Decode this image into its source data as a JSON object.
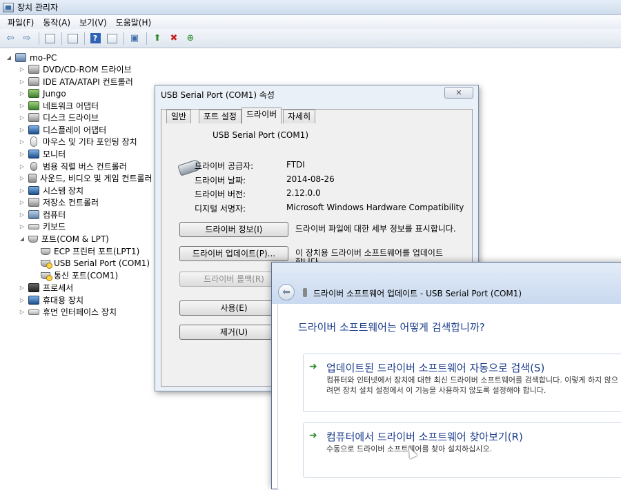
{
  "main_window": {
    "title": "장치 관리자",
    "menu": [
      "파일(F)",
      "동작(A)",
      "보기(V)",
      "도움말(H)"
    ]
  },
  "toolbar": {
    "icons": [
      "back-arrow-icon",
      "forward-arrow-icon",
      "console-tree-icon",
      "properties-icon",
      "help-icon",
      "action-pane-icon",
      "scan-hardware-icon",
      "update-driver-icon",
      "uninstall-icon",
      "enable-device-icon"
    ]
  },
  "tree": {
    "root": "mo-PC",
    "items": [
      {
        "label": "DVD/CD-ROM 드라이브",
        "icon": "disk-icon"
      },
      {
        "label": "IDE ATA/ATAPI 컨트롤러",
        "icon": "controller-icon"
      },
      {
        "label": "Jungo",
        "icon": "network-icon"
      },
      {
        "label": "네트워크 어댑터",
        "icon": "network-adapter-icon"
      },
      {
        "label": "디스크 드라이브",
        "icon": "disk-drive-icon"
      },
      {
        "label": "디스플레이 어댑터",
        "icon": "display-adapter-icon"
      },
      {
        "label": "마우스 및 기타 포인팅 장치",
        "icon": "mouse-icon"
      },
      {
        "label": "모니터",
        "icon": "monitor-icon"
      },
      {
        "label": "범용 직렬 버스 컨트롤러",
        "icon": "usb-icon"
      },
      {
        "label": "사운드, 비디오 및 게임 컨트롤러",
        "icon": "sound-icon"
      },
      {
        "label": "시스템 장치",
        "icon": "system-icon"
      },
      {
        "label": "저장소 컨트롤러",
        "icon": "storage-controller-icon"
      },
      {
        "label": "컴퓨터",
        "icon": "computer-icon"
      },
      {
        "label": "키보드",
        "icon": "keyboard-icon"
      },
      {
        "label": "포트(COM & LPT)",
        "icon": "port-icon"
      }
    ],
    "port_children": [
      {
        "label": "ECP 프린터 포트(LPT1)",
        "icon": "port-icon"
      },
      {
        "label": "USB Serial Port (COM1)",
        "icon": "port-warning-icon"
      },
      {
        "label": "통신 포트(COM1)",
        "icon": "port-warning-icon"
      }
    ],
    "after_items": [
      {
        "label": "프로세서",
        "icon": "processor-icon"
      },
      {
        "label": "휴대용 장치",
        "icon": "portable-device-icon"
      },
      {
        "label": "휴먼 인터페이스 장치",
        "icon": "hid-icon"
      }
    ]
  },
  "properties_dialog": {
    "title": "USB Serial Port (COM1) 속성",
    "close_label": "✕",
    "tabs": [
      "일반",
      "포트 설정",
      "드라이버",
      "자세히"
    ],
    "active_tab": "드라이버",
    "device_name": "USB Serial Port (COM1)",
    "fields": [
      {
        "label": "드라이버 공급자:",
        "value": "FTDI"
      },
      {
        "label": "드라이버 날짜:",
        "value": "2014-08-26"
      },
      {
        "label": "드라이버 버전:",
        "value": "2.12.0.0"
      },
      {
        "label": "디지털 서명자:",
        "value": "Microsoft Windows Hardware Compatibility"
      }
    ],
    "buttons": [
      {
        "label": "드라이버 정보(I)",
        "desc": "드라이버 파일에 대한 세부 정보를 표시합니다.",
        "enabled": true
      },
      {
        "label": "드라이버 업데이트(P)...",
        "desc": "이 장치용 드라이버 소프트웨어를 업데이트",
        "desc2": "합니다.",
        "enabled": true
      },
      {
        "label": "드라이버 롤백(R)",
        "desc": "",
        "enabled": false
      },
      {
        "label": "사용(E)",
        "desc": "",
        "enabled": true
      },
      {
        "label": "제거(U)",
        "desc": "",
        "enabled": true
      }
    ]
  },
  "update_wizard": {
    "title": "드라이버 소프트웨어 업데이트 - USB Serial Port (COM1)",
    "question": "드라이버 소프트웨어는 어떻게 검색합니까?",
    "options": [
      {
        "title": "업데이트된 드라이버 소프트웨어 자동으로 검색(S)",
        "desc": "컴퓨터와 인터넷에서 장치에 대한 최신 드라이버 소프트웨어를 검색합니다. 이렇게 하지 않으려면 장치 설치 설정에서 이 기능을 사용하지 않도록 설정해야 합니다."
      },
      {
        "title": "컴퓨터에서 드라이버 소프트웨어 찾아보기(R)",
        "desc": "수동으로 드라이버 소프트웨어를 찾아 설치하십시오."
      }
    ]
  }
}
